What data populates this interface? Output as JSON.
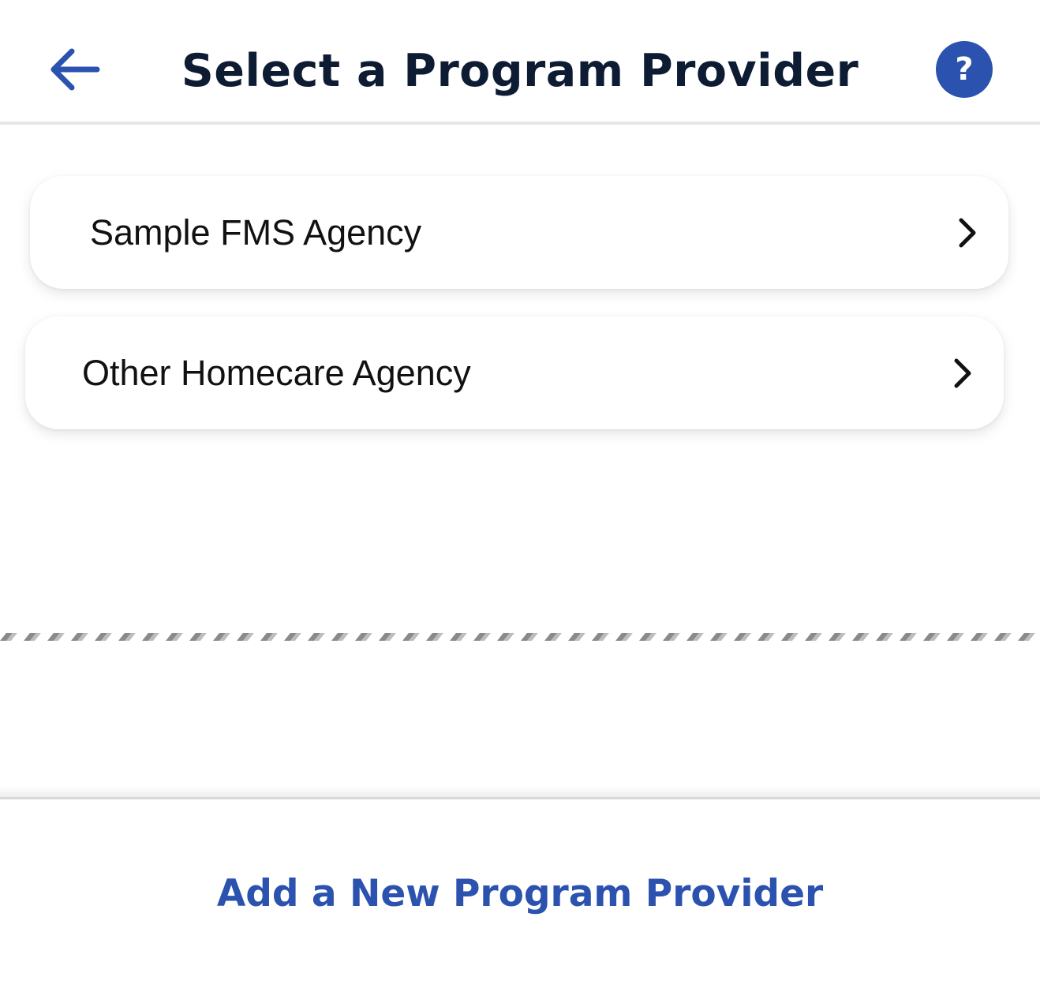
{
  "header": {
    "title": "Select a Program Provider",
    "back_icon": "arrow-left-icon",
    "help_icon": "question-mark-icon",
    "help_glyph": "?"
  },
  "providers": [
    {
      "label": "Sample FMS Agency",
      "icon": "chevron-right-icon"
    },
    {
      "label": "Other Homecare Agency",
      "icon": "chevron-right-icon"
    }
  ],
  "footer": {
    "add_label": "Add a New Program Provider"
  },
  "colors": {
    "accent": "#2b52ae",
    "title_text": "#0d1b33",
    "item_text": "#111111",
    "background": "#ffffff"
  }
}
